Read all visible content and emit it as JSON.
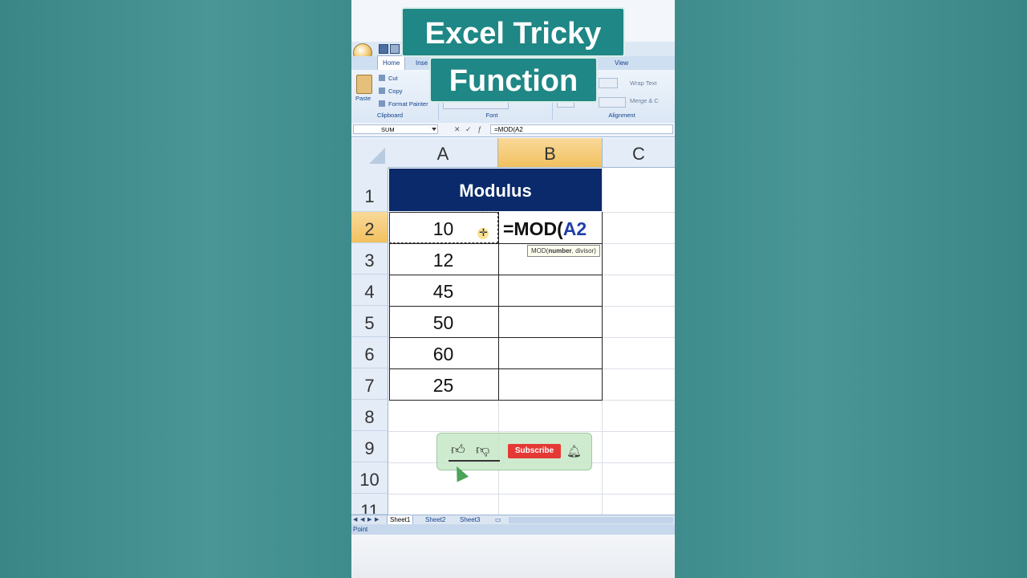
{
  "overlay": {
    "title_line1": "Excel Tricky",
    "title_line2": "Function"
  },
  "ribbon": {
    "tabs": [
      "Home",
      "Inse",
      "View"
    ],
    "clipboard": {
      "paste": "Paste",
      "cut": "Cut",
      "copy": "Copy",
      "format_painter": "Format Painter"
    },
    "groups": {
      "clipboard": "Clipboard",
      "font": "Font",
      "alignment": "Alignment"
    },
    "alignment": {
      "wrap_text": "Wrap Text",
      "merge": "Merge & C"
    }
  },
  "formula_bar": {
    "name_box": "SUM",
    "formula": "=MOD(A2"
  },
  "grid": {
    "columns": [
      "A",
      "B",
      "C"
    ],
    "rows": [
      "1",
      "2",
      "3",
      "4",
      "5",
      "6",
      "7",
      "8",
      "9",
      "10",
      "11"
    ],
    "header_title": "Modulus",
    "values": [
      "10",
      "12",
      "45",
      "50",
      "60",
      "25"
    ],
    "active_formula": {
      "prefix": "=MOD(",
      "ref": "A2"
    },
    "tooltip": {
      "fn": "MOD(",
      "arg1": "number",
      "rest": ", divisor)"
    }
  },
  "widget": {
    "subscribe": "Subscribe"
  },
  "sheets": [
    "Sheet1",
    "Sheet2",
    "Sheet3"
  ],
  "status": "Point",
  "colors": {
    "header_fill": "#0b2a6b",
    "selected_header": "#f1c15f",
    "subscribe_red": "#e53935",
    "ref_blue": "#1f3fa8"
  }
}
